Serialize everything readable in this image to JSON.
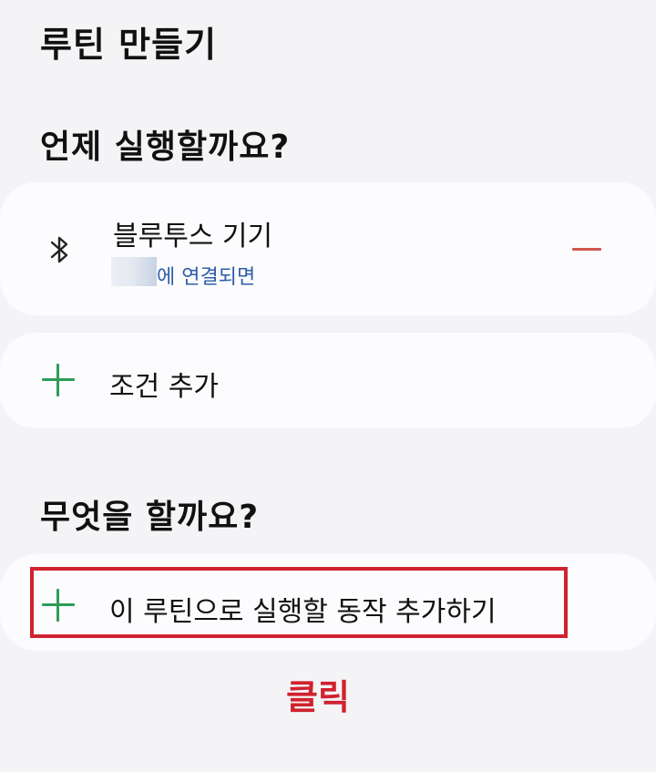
{
  "header": {
    "title": "루틴 만들기"
  },
  "when_section": {
    "title": "언제 실행할까요?",
    "trigger": {
      "icon": "bluetooth-icon",
      "title": "블루투스 기기",
      "subtitle": "에 연결되면"
    },
    "add_condition_label": "조건 추가"
  },
  "what_section": {
    "title": "무엇을 할까요?",
    "add_action_label": "이 루틴으로 실행할 동작 추가하기"
  },
  "annotation": {
    "label": "클릭",
    "color": "#d0222f"
  },
  "colors": {
    "accent_green": "#2e9c5a",
    "remove_red": "#d2564e",
    "link_blue": "#2f5ea8",
    "background": "#f4f4f6",
    "card": "#fcfcfe"
  }
}
